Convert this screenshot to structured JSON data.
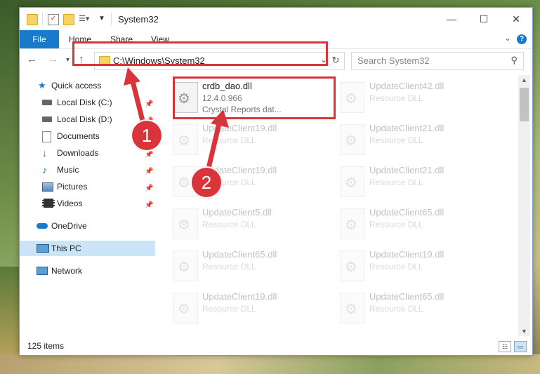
{
  "window": {
    "title": "System32",
    "controls": {
      "minimize": "—",
      "maximize": "☐",
      "close": "✕"
    }
  },
  "ribbon": {
    "tabs": [
      {
        "label": "File"
      },
      {
        "label": "Home"
      },
      {
        "label": "Share"
      },
      {
        "label": "View"
      }
    ],
    "help": "?"
  },
  "navigation": {
    "address": "C:\\Windows\\System32",
    "search_placeholder": "Search System32"
  },
  "sidebar": {
    "items": [
      {
        "label": "Quick access",
        "icon": "star-icon"
      },
      {
        "label": "Local Disk (C:)",
        "icon": "drive-icon",
        "pinned": true
      },
      {
        "label": "Local Disk (D:)",
        "icon": "drive-icon",
        "pinned": true
      },
      {
        "label": "Documents",
        "icon": "documents-icon",
        "pinned": true
      },
      {
        "label": "Downloads",
        "icon": "download-icon",
        "pinned": true
      },
      {
        "label": "Music",
        "icon": "music-icon",
        "pinned": true
      },
      {
        "label": "Pictures",
        "icon": "pictures-icon",
        "pinned": true
      },
      {
        "label": "Videos",
        "icon": "videos-icon",
        "pinned": true
      },
      {
        "label": "OneDrive",
        "icon": "cloud-icon"
      },
      {
        "label": "This PC",
        "icon": "computer-icon",
        "selected": true
      },
      {
        "label": "Network",
        "icon": "network-icon"
      }
    ]
  },
  "files": [
    {
      "name": "crdb_dao.dll",
      "line1": "12.4.0.966",
      "line2": "Crystal Reports dat...",
      "highlighted": true
    },
    {
      "name": "UpdateClient42.dll",
      "line1": "Resource DLL"
    },
    {
      "name": "UpdateClient19.dll",
      "line1": "Resource DLL"
    },
    {
      "name": "UpdateClient21.dll",
      "line1": "Resource DLL"
    },
    {
      "name": "UpdateClient19.dll",
      "line1": "Resource DLL"
    },
    {
      "name": "UpdateClient21.dll",
      "line1": "Resource DLL"
    },
    {
      "name": "UpdateClient5.dll",
      "line1": "Resource DLL"
    },
    {
      "name": "UpdateClient65.dll",
      "line1": "Resource DLL"
    },
    {
      "name": "UpdateClient65.dll",
      "line1": "Resource DLL"
    },
    {
      "name": "UpdateClient19.dll",
      "line1": "Resource DLL"
    },
    {
      "name": "UpdateClient19.dll",
      "line1": "Resource DLL"
    },
    {
      "name": "UpdateClient65.dll",
      "line1": "Resource DLL"
    }
  ],
  "status": {
    "count": "125 items"
  },
  "annotations": {
    "step1": "1",
    "step2": "2"
  },
  "colors": {
    "accent": "#1979ca",
    "highlight": "#d9343a",
    "selected": "#cce4f7"
  }
}
